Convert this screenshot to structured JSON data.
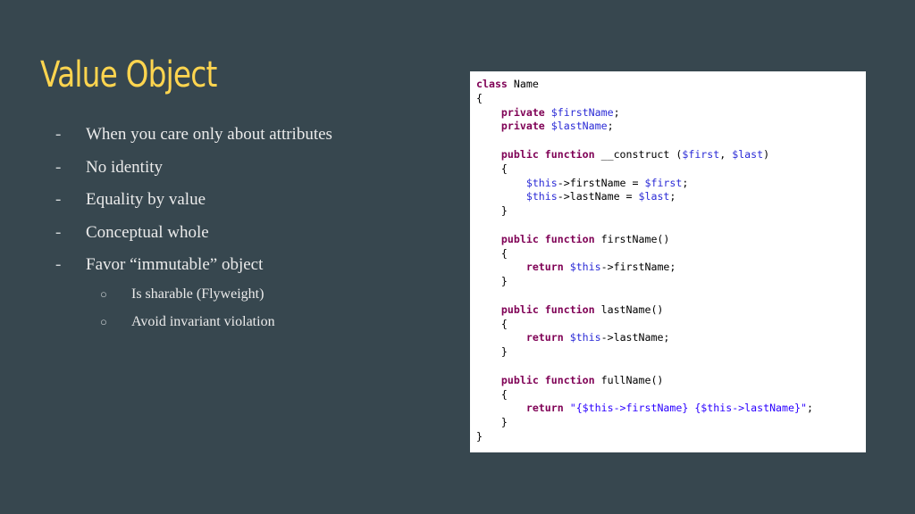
{
  "slide": {
    "title": "Value Object",
    "bullets": [
      {
        "marker": "-",
        "text": "When you care only about attributes"
      },
      {
        "marker": "-",
        "text": "No identity"
      },
      {
        "marker": "-",
        "text": "Equality by value"
      },
      {
        "marker": "-",
        "text": "Conceptual whole"
      },
      {
        "marker": "-",
        "text": "Favor “immutable” object"
      }
    ],
    "sub_bullets": [
      {
        "marker": "○",
        "text": "Is sharable (Flyweight)"
      },
      {
        "marker": "○",
        "text": "Avoid invariant violation"
      }
    ]
  },
  "code": {
    "lines": [
      [
        {
          "t": "kw",
          "v": "class"
        },
        {
          "t": "plain",
          "v": " Name"
        }
      ],
      [
        {
          "t": "plain",
          "v": "{"
        }
      ],
      [
        {
          "t": "plain",
          "v": "    "
        },
        {
          "t": "kw",
          "v": "private"
        },
        {
          "t": "plain",
          "v": " "
        },
        {
          "t": "var",
          "v": "$firstName"
        },
        {
          "t": "plain",
          "v": ";"
        }
      ],
      [
        {
          "t": "plain",
          "v": "    "
        },
        {
          "t": "kw",
          "v": "private"
        },
        {
          "t": "plain",
          "v": " "
        },
        {
          "t": "var",
          "v": "$lastName"
        },
        {
          "t": "plain",
          "v": ";"
        }
      ],
      [],
      [
        {
          "t": "plain",
          "v": "    "
        },
        {
          "t": "kw",
          "v": "public function"
        },
        {
          "t": "plain",
          "v": " __construct ("
        },
        {
          "t": "var",
          "v": "$first"
        },
        {
          "t": "plain",
          "v": ", "
        },
        {
          "t": "var",
          "v": "$last"
        },
        {
          "t": "plain",
          "v": ")"
        }
      ],
      [
        {
          "t": "plain",
          "v": "    {"
        }
      ],
      [
        {
          "t": "plain",
          "v": "        "
        },
        {
          "t": "var",
          "v": "$this"
        },
        {
          "t": "plain",
          "v": "->firstName = "
        },
        {
          "t": "var",
          "v": "$first"
        },
        {
          "t": "plain",
          "v": ";"
        }
      ],
      [
        {
          "t": "plain",
          "v": "        "
        },
        {
          "t": "var",
          "v": "$this"
        },
        {
          "t": "plain",
          "v": "->lastName = "
        },
        {
          "t": "var",
          "v": "$last"
        },
        {
          "t": "plain",
          "v": ";"
        }
      ],
      [
        {
          "t": "plain",
          "v": "    }"
        }
      ],
      [],
      [
        {
          "t": "plain",
          "v": "    "
        },
        {
          "t": "kw",
          "v": "public function"
        },
        {
          "t": "plain",
          "v": " firstName()"
        }
      ],
      [
        {
          "t": "plain",
          "v": "    {"
        }
      ],
      [
        {
          "t": "plain",
          "v": "        "
        },
        {
          "t": "kw",
          "v": "return"
        },
        {
          "t": "plain",
          "v": " "
        },
        {
          "t": "var",
          "v": "$this"
        },
        {
          "t": "plain",
          "v": "->firstName;"
        }
      ],
      [
        {
          "t": "plain",
          "v": "    }"
        }
      ],
      [],
      [
        {
          "t": "plain",
          "v": "    "
        },
        {
          "t": "kw",
          "v": "public function"
        },
        {
          "t": "plain",
          "v": " lastName()"
        }
      ],
      [
        {
          "t": "plain",
          "v": "    {"
        }
      ],
      [
        {
          "t": "plain",
          "v": "        "
        },
        {
          "t": "kw",
          "v": "return"
        },
        {
          "t": "plain",
          "v": " "
        },
        {
          "t": "var",
          "v": "$this"
        },
        {
          "t": "plain",
          "v": "->lastName;"
        }
      ],
      [
        {
          "t": "plain",
          "v": "    }"
        }
      ],
      [],
      [
        {
          "t": "plain",
          "v": "    "
        },
        {
          "t": "kw",
          "v": "public function"
        },
        {
          "t": "plain",
          "v": " fullName()"
        }
      ],
      [
        {
          "t": "plain",
          "v": "    {"
        }
      ],
      [
        {
          "t": "plain",
          "v": "        "
        },
        {
          "t": "kw",
          "v": "return"
        },
        {
          "t": "plain",
          "v": " "
        },
        {
          "t": "str",
          "v": "\"{$this->firstName} {$this->lastName}\""
        },
        {
          "t": "plain",
          "v": ";"
        }
      ],
      [
        {
          "t": "plain",
          "v": "    }"
        }
      ],
      [
        {
          "t": "plain",
          "v": "}"
        }
      ]
    ]
  },
  "colors": {
    "background": "#37474f",
    "title": "#ffd54f",
    "body_text": "#ebebeb",
    "code_keyword": "#7f0055",
    "code_variable": "#2b2bd6",
    "code_string": "#2a00ff"
  }
}
